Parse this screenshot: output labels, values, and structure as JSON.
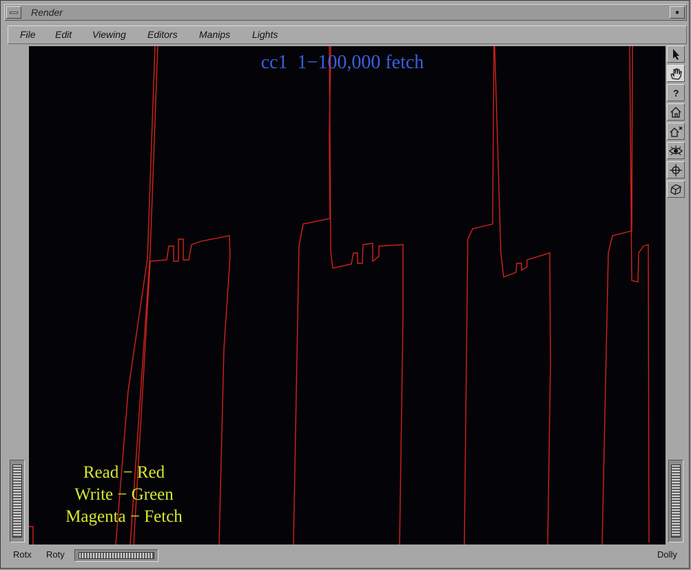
{
  "window": {
    "title": "Render"
  },
  "menu": [
    {
      "id": "file",
      "label": "File"
    },
    {
      "id": "edit",
      "label": "Edit"
    },
    {
      "id": "viewing",
      "label": "Viewing"
    },
    {
      "id": "editors",
      "label": "Editors"
    },
    {
      "id": "manips",
      "label": "Manips"
    },
    {
      "id": "lights",
      "label": "Lights"
    }
  ],
  "viewport": {
    "title": "cc1  1−100,000 fetch",
    "legend": [
      "Read − Red",
      "Write − Green",
      "Magenta − Fetch"
    ],
    "background": "#040408",
    "trace_color": "#d2231c"
  },
  "tools": [
    {
      "id": "pick",
      "icon": "arrow-cursor-icon"
    },
    {
      "id": "view",
      "icon": "hand-icon"
    },
    {
      "id": "help",
      "icon": "question-mark-icon"
    },
    {
      "id": "home",
      "icon": "home-icon"
    },
    {
      "id": "set-home",
      "icon": "set-home-icon"
    },
    {
      "id": "view-all",
      "icon": "eye-icon"
    },
    {
      "id": "seek",
      "icon": "crosshair-icon"
    },
    {
      "id": "projection",
      "icon": "perspective-cube-icon"
    }
  ],
  "bottom": {
    "rotx": "Rotx",
    "roty": "Roty",
    "dolly": "Dolly"
  }
}
